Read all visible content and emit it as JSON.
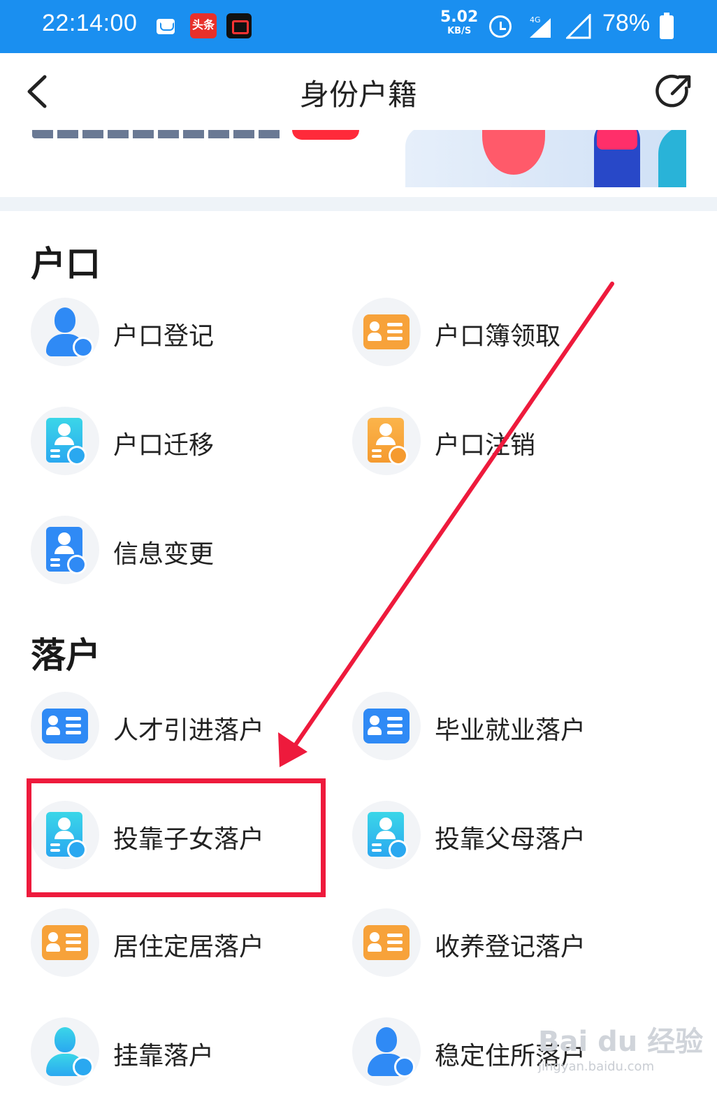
{
  "status_bar": {
    "time": "22:14:00",
    "toutiao_label": "头条",
    "speed_value": "5.02",
    "speed_unit": "KB/S",
    "network": "4G",
    "battery": "78%"
  },
  "nav": {
    "title": "身份户籍",
    "back_icon": "chevron-left-icon",
    "share_icon": "share-icon"
  },
  "sections": [
    {
      "title": "户口",
      "items": [
        {
          "label": "户口登记",
          "icon": "person-edit-icon",
          "color": "#2f8af5"
        },
        {
          "label": "户口簿领取",
          "icon": "id-card-icon",
          "color": "#f7a23a"
        },
        {
          "label": "户口迁移",
          "icon": "doc-transfer-icon",
          "color": "#2aa8f0"
        },
        {
          "label": "户口注销",
          "icon": "doc-cancel-icon",
          "color": "#f59a2f"
        },
        {
          "label": "信息变更",
          "icon": "doc-exchange-icon",
          "color": "#2f8af5"
        }
      ]
    },
    {
      "title": "落户",
      "items": [
        {
          "label": "人才引进落户",
          "icon": "id-card-icon",
          "color": "#2f8af5"
        },
        {
          "label": "毕业就业落户",
          "icon": "id-card-icon",
          "color": "#2f8af5"
        },
        {
          "label": "投靠子女落户",
          "icon": "doc-transfer-icon",
          "color": "#2aa8f0"
        },
        {
          "label": "投靠父母落户",
          "icon": "doc-transfer-icon",
          "color": "#2aa8f0"
        },
        {
          "label": "居住定居落户",
          "icon": "id-card-icon",
          "color": "#f7a23a"
        },
        {
          "label": "收养登记落户",
          "icon": "id-card-icon",
          "color": "#f7a23a"
        },
        {
          "label": "挂靠落户",
          "icon": "person-edit-icon",
          "color": "#2aa8f0"
        },
        {
          "label": "稳定住所落户",
          "icon": "person-edit-icon",
          "color": "#2f8af5"
        }
      ]
    }
  ],
  "annotation": {
    "highlight_color": "#ee1a3c"
  },
  "watermark": {
    "logo": "Bai du 经验",
    "url": "jingyan.baidu.com"
  }
}
